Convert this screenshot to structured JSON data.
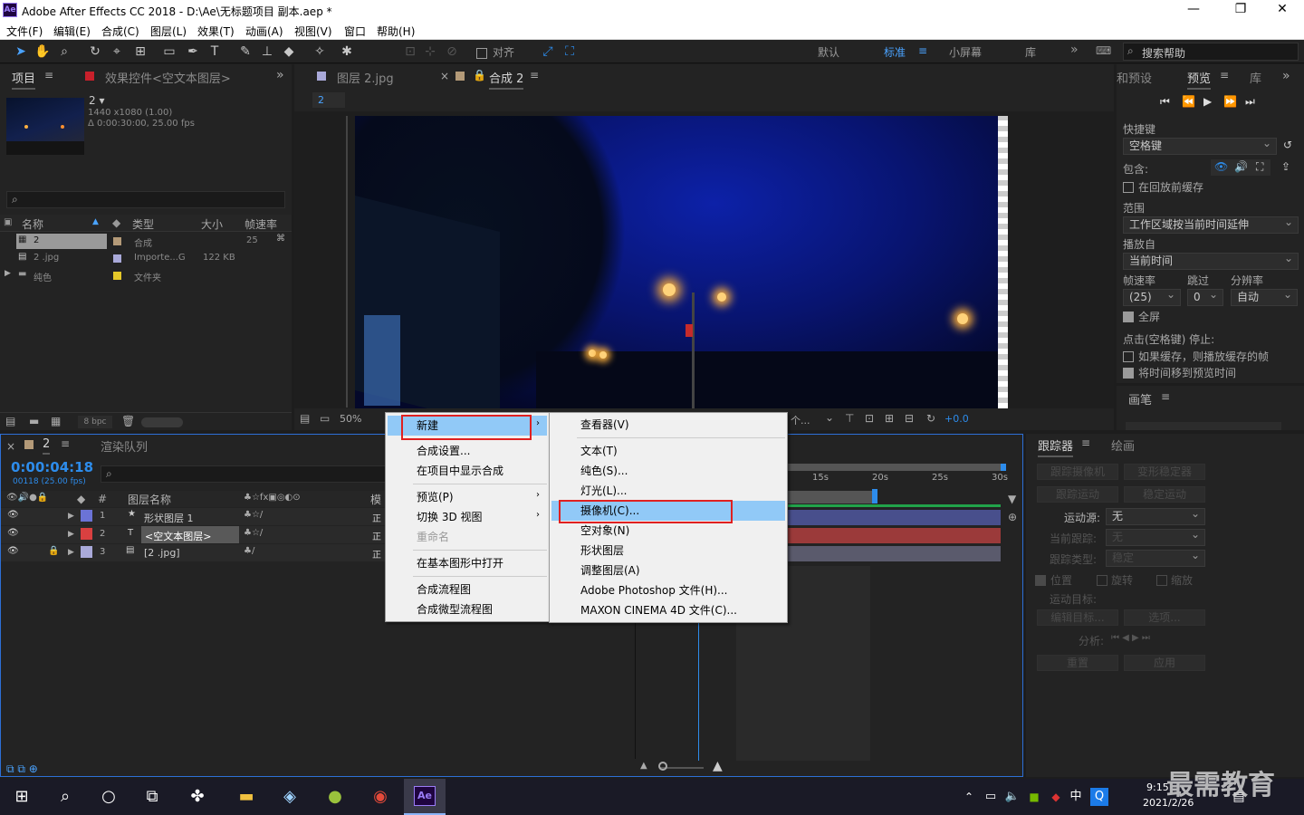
{
  "title": "Adobe After Effects CC 2018 - D:\\Ae\\无标题项目 副本.aep *",
  "window_controls": [
    "—",
    "❐",
    "✕"
  ],
  "menus": [
    "文件(F)",
    "编辑(E)",
    "合成(C)",
    "图层(L)",
    "效果(T)",
    "动画(A)",
    "视图(V)",
    "窗口",
    "帮助(H)"
  ],
  "toolbar": {
    "snap_label": "对齐",
    "workspaces": [
      "默认",
      "标准",
      "小屏幕",
      "库"
    ],
    "active_workspace": "标准",
    "search_placeholder": "搜索帮助"
  },
  "project": {
    "tab": "项目",
    "effects_tab": "效果控件<空文本图层>",
    "comp_name": "2 ▾",
    "comp_size": "1440 x1080 (1.00)",
    "comp_duration": "Δ 0:00:30:00, 25.00 fps",
    "columns": [
      "名称",
      "类型",
      "大小",
      "帧速率"
    ],
    "items": [
      {
        "name": "2",
        "type": "合成",
        "size": "",
        "fps": "25"
      },
      {
        "name": "2 .jpg",
        "type": "Importe...G",
        "size": "122 KB",
        "fps": ""
      },
      {
        "name": "纯色",
        "type": "文件夹",
        "size": "",
        "fps": ""
      }
    ],
    "bpc": "8 bpc"
  },
  "viewer": {
    "tab_layer": "图层 2.jpg",
    "tab_comp": "合成 2",
    "comp_chip": "2",
    "zoom": "50%",
    "exposure": "+0.0",
    "view_label": "个..."
  },
  "preview": {
    "tabs": [
      "和预设",
      "预览",
      "库"
    ],
    "shortcut_label": "快捷键",
    "shortcut_value": "空格键",
    "include_label": "包含:",
    "cache_before": "在回放前缓存",
    "range_label": "范围",
    "range_value": "工作区域按当前时间延伸",
    "play_from_label": "播放自",
    "play_from_value": "当前时间",
    "fps_label": "帧速率",
    "skip_label": "跳过",
    "res_label": "分辨率",
    "fps_value": "(25)",
    "skip_value": "0",
    "res_value": "自动",
    "fullscreen": "全屏",
    "stop_label": "点击(空格键) 停止:",
    "if_cached": "如果缓存，则播放缓存的帧",
    "move_time": "将时间移到预览时间",
    "brush_tab": "画笔"
  },
  "timeline": {
    "tab": "2",
    "render_queue": "渲染队列",
    "timecode": "0:00:04:18",
    "frames": "00118 (25.00 fps)",
    "layer_col": "图层名称",
    "mode_col": "模",
    "ruler": [
      "15s",
      "20s",
      "25s",
      "30s"
    ],
    "layers": [
      {
        "num": "1",
        "name": "形状图层 1",
        "mode": "正",
        "color": "#6b73d6"
      },
      {
        "num": "2",
        "name": "<空文本图层>",
        "mode": "正",
        "color": "#d94040"
      },
      {
        "num": "3",
        "name": "[2 .jpg]",
        "mode": "正",
        "color": "#a9a9d9"
      }
    ]
  },
  "tracker": {
    "tab": "跟踪器",
    "paint_tab": "绘画",
    "track_camera": "跟踪摄像机",
    "warp_stab": "变形稳定器",
    "track_motion": "跟踪运动",
    "stabilize": "稳定运动",
    "motion_source_label": "运动源:",
    "motion_source": "无",
    "current_track_label": "当前跟踪:",
    "current_track": "无",
    "track_type_label": "跟踪类型:",
    "track_type": "稳定",
    "position": "位置",
    "rotation": "旋转",
    "scale": "缩放",
    "motion_target": "运动目标:",
    "edit_target": "编辑目标...",
    "options": "选项...",
    "analyze": "分析:",
    "reset": "重置",
    "apply": "应用"
  },
  "context_menu": {
    "items": [
      "新建",
      "合成设置...",
      "在项目中显示合成",
      "预览(P)",
      "切换 3D 视图",
      "重命名",
      "在基本图形中打开",
      "合成流程图",
      "合成微型流程图"
    ]
  },
  "submenu": {
    "items": [
      "查看器(V)",
      "文本(T)",
      "纯色(S)...",
      "灯光(L)...",
      "摄像机(C)...",
      "空对象(N)",
      "形状图层",
      "调整图层(A)",
      "Adobe Photoshop 文件(H)...",
      "MAXON CINEMA 4D 文件(C)..."
    ]
  },
  "taskbar": {
    "time": "9:15",
    "date": "2021/2/26",
    "ime": "中",
    "watermark": "最需教育"
  }
}
